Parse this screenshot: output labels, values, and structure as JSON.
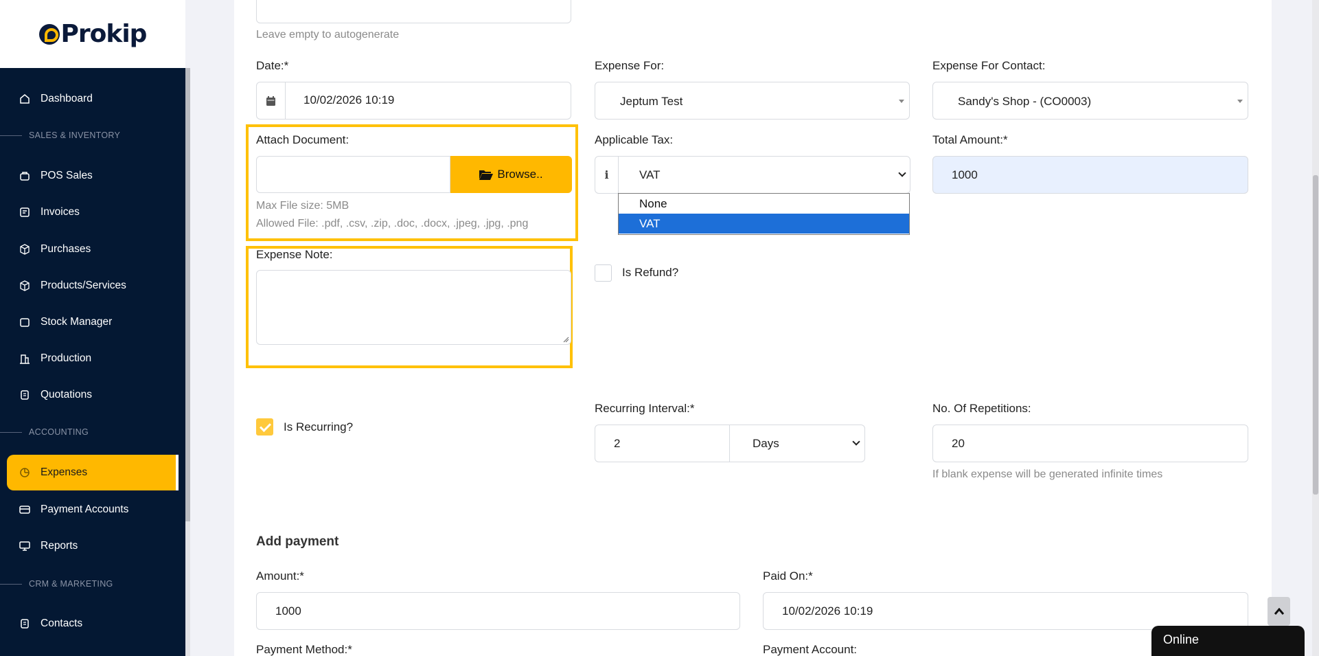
{
  "brand": {
    "name": "Prokip"
  },
  "sidebar": {
    "items": [
      {
        "label": "Dashboard",
        "icon": "home-icon"
      },
      {
        "label": "POS Sales",
        "icon": "bag-icon"
      },
      {
        "label": "Invoices",
        "icon": "invoice-icon"
      },
      {
        "label": "Purchases",
        "icon": "box-icon"
      },
      {
        "label": "Products/Services",
        "icon": "cube-icon"
      },
      {
        "label": "Stock Manager",
        "icon": "folder-icon"
      },
      {
        "label": "Production",
        "icon": "building-icon"
      },
      {
        "label": "Quotations",
        "icon": "doc-icon"
      },
      {
        "label": "Expenses",
        "icon": "pie-chart-icon",
        "active": true
      },
      {
        "label": "Payment Accounts",
        "icon": "card-icon"
      },
      {
        "label": "Reports",
        "icon": "monitor-icon"
      },
      {
        "label": "Contacts",
        "icon": "contacts-icon"
      }
    ],
    "sections": [
      "SALES & INVENTORY",
      "ACCOUNTING",
      "CRM & MARKETING"
    ]
  },
  "form": {
    "ref_help": "Leave empty to autogenerate",
    "date": {
      "label": "Date:*",
      "value": "10/02/2026 10:19"
    },
    "expense_for": {
      "label": "Expense For:",
      "value": "Jeptum Test"
    },
    "expense_for_contact": {
      "label": "Expense For Contact:",
      "value": "Sandy's Shop - (CO0003)"
    },
    "attach": {
      "label": "Attach Document:",
      "browse_label": "Browse..",
      "max_size": "Max File size: 5MB",
      "allowed": "Allowed File: .pdf, .csv, .zip, .doc, .docx, .jpeg, .jpg, .png"
    },
    "tax": {
      "label": "Applicable Tax:",
      "value": "VAT",
      "options": [
        "None",
        "VAT"
      ],
      "selected_option": "VAT"
    },
    "total": {
      "label": "Total Amount:*",
      "value": "1000"
    },
    "note": {
      "label": "Expense Note:",
      "value": ""
    },
    "refund": {
      "label": "Is Refund?",
      "checked": false
    },
    "recurring": {
      "label": "Is Recurring?",
      "checked": true
    },
    "interval": {
      "label": "Recurring Interval:*",
      "value": "2",
      "unit": "Days"
    },
    "repetitions": {
      "label": "No. Of Repetitions:",
      "value": "20",
      "help": "If blank expense will be generated infinite times"
    }
  },
  "payment": {
    "title": "Add payment",
    "amount": {
      "label": "Amount:*",
      "value": "1000"
    },
    "paid_on": {
      "label": "Paid On:*",
      "value": "10/02/2026 10:19"
    },
    "method_label": "Payment Method:*",
    "account_label": "Payment Account:"
  },
  "chat": {
    "status": "Online"
  },
  "colors": {
    "accent": "#ffb800",
    "sidebar": "#041833",
    "highlight": "#ffc107",
    "selected_option": "#1d6fd8"
  }
}
